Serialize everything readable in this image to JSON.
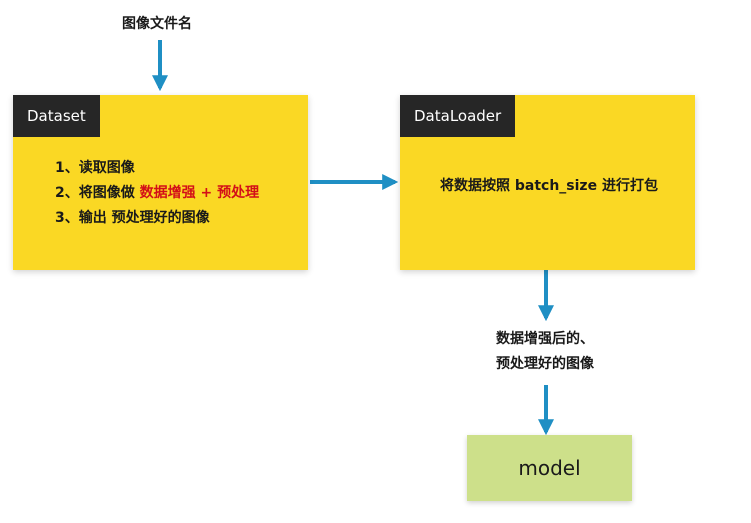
{
  "input_label": "图像文件名",
  "dataset_box": {
    "title": "Dataset",
    "lines": {
      "line1": "1、读取图像",
      "line2_prefix": "2、将图像做",
      "line2_highlight": "数据增强 + 预处理",
      "line3": "3、输出 预处理好的图像"
    }
  },
  "dataloader_box": {
    "title": "DataLoader",
    "text": "将数据按照 batch_size 进行打包"
  },
  "output_label": {
    "line1": "数据增强后的、",
    "line2": "预处理好的图像"
  },
  "model_box": {
    "label": "model"
  },
  "colors": {
    "box_fill": "#fad824",
    "tag_fill": "#262626",
    "arrow": "#1f8fc4",
    "highlight": "#d30f18",
    "model_fill": "#cde08a"
  }
}
